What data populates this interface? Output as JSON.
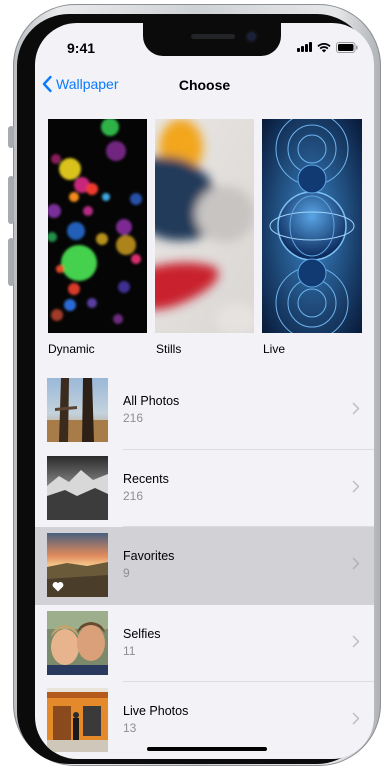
{
  "status": {
    "time": "9:41"
  },
  "nav": {
    "back_label": "Wallpaper",
    "title": "Choose"
  },
  "wallpaper_types": [
    {
      "label": "Dynamic"
    },
    {
      "label": "Stills"
    },
    {
      "label": "Live"
    }
  ],
  "albums": [
    {
      "title": "All Photos",
      "count": "216"
    },
    {
      "title": "Recents",
      "count": "216"
    },
    {
      "title": "Favorites",
      "count": "9"
    },
    {
      "title": "Selfies",
      "count": "11"
    },
    {
      "title": "Live Photos",
      "count": "13"
    }
  ],
  "colors": {
    "accent": "#0a7aff",
    "selected_row": "#d1d1d6",
    "background": "#f2f2f7"
  },
  "icons": [
    "chevron-left-icon",
    "signal-icon",
    "wifi-icon",
    "battery-icon",
    "chevron-right-icon",
    "heart-icon"
  ]
}
